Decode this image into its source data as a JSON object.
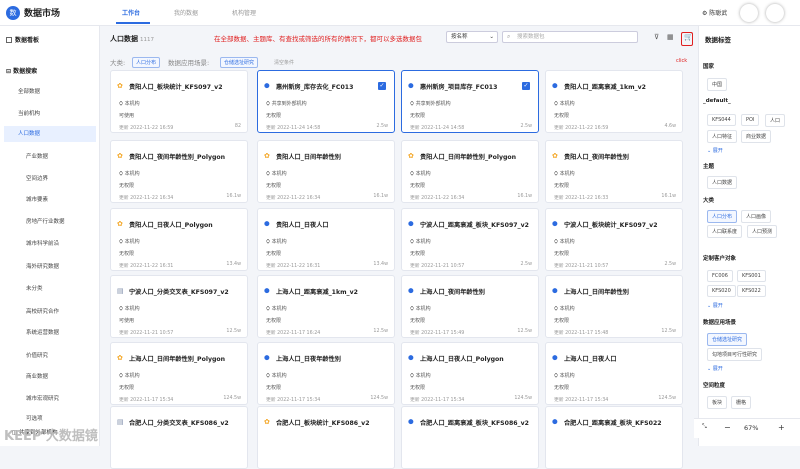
{
  "app": {
    "title": "数据市场",
    "logo_text": "数"
  },
  "top_tabs": [
    {
      "label": "工作台",
      "active": true
    },
    {
      "label": "我的数据"
    },
    {
      "label": "机构管理"
    }
  ],
  "user": {
    "name": "陈聪武"
  },
  "sidebar": {
    "board": "数据看板",
    "search_section": "数据搜索",
    "all_data": "全部数据",
    "current_org": "当前机构",
    "items": [
      "人口数据",
      "产业数据",
      "空间边界",
      "城市要素",
      "房地产行业数据",
      "城市科学前沿",
      "海外研究数据",
      "未分类",
      "高校研究合作",
      "系统运营数据",
      "价值研究",
      "商业数据",
      "城市宏观研究",
      "可选项"
    ],
    "active_item": "人口数据",
    "bottom": "共享到外部机构"
  },
  "main": {
    "title": "人口数据",
    "count": "1117",
    "sort": "按名称",
    "search_placeholder": "搜索数据包",
    "filter_label_big": "大类:",
    "filter_chip_1": "人口分布",
    "filter_label_scene": "数据应用场景:",
    "filter_chip_2": "仓储选址研究",
    "clear": "清空条件",
    "annotation": "在全部数据、主题库、有查找或筛选的所有的情况下，都可以多选数据包",
    "click_label": "click"
  },
  "cards": [
    {
      "icon": "cube",
      "title": "贵阳人口_板块统计_KFS097_v2",
      "org": "本机构",
      "perm": "可使用",
      "updated": "更新 2022-11-22 16:59",
      "size": "82"
    },
    {
      "icon": "pin",
      "title": "惠州新房_库存去化_FC013",
      "org": "共享到外部机构",
      "perm": "无权限",
      "updated": "更新 2022-11-24 14:58",
      "size": "2.5w",
      "selected": true
    },
    {
      "icon": "pin",
      "title": "惠州新房_项目库存_FC013",
      "org": "共享到外部机构",
      "perm": "无权限",
      "updated": "更新 2022-11-24 14:58",
      "size": "2.5w",
      "selected": true
    },
    {
      "icon": "pin",
      "title": "贵阳人口_距离衰减_1km_v2",
      "org": "本机构",
      "perm": "无权限",
      "updated": "更新 2022-11-22 16:59",
      "size": "4.6w"
    },
    {
      "icon": "cube",
      "title": "贵阳人口_夜间年龄性别_Polygon",
      "org": "本机构",
      "perm": "无权限",
      "updated": "更新 2022-11-22 16:34",
      "size": "16.1w"
    },
    {
      "icon": "cube",
      "title": "贵阳人口_日间年龄性别",
      "org": "本机构",
      "perm": "无权限",
      "updated": "更新 2022-11-22 16:34",
      "size": "16.1w"
    },
    {
      "icon": "cube",
      "title": "贵阳人口_日间年龄性别_Polygon",
      "org": "本机构",
      "perm": "无权限",
      "updated": "更新 2022-11-22 16:34",
      "size": "16.1w"
    },
    {
      "icon": "cube",
      "title": "贵阳人口_夜间年龄性别",
      "org": "本机构",
      "perm": "无权限",
      "updated": "更新 2022-11-22 16:33",
      "size": "16.1w"
    },
    {
      "icon": "cube",
      "title": "贵阳人口_日夜人口_Polygon",
      "org": "本机构",
      "perm": "无权限",
      "updated": "更新 2022-11-22 16:31",
      "size": "13.4w"
    },
    {
      "icon": "pin",
      "title": "贵阳人口_日夜人口",
      "org": "本机构",
      "perm": "无权限",
      "updated": "更新 2022-11-22 16:31",
      "size": "13.4w"
    },
    {
      "icon": "pin",
      "title": "宁波人口_距离衰减_板块_KFS097_v2",
      "org": "本机构",
      "perm": "无权限",
      "updated": "更新 2022-11-21 10:57",
      "size": "2.5w"
    },
    {
      "icon": "pin",
      "title": "宁波人口_板块统计_KFS097_v2",
      "org": "本机构",
      "perm": "无权限",
      "updated": "更新 2022-11-21 10:57",
      "size": "2.5w"
    },
    {
      "icon": "doc",
      "title": "宁波人口_分类交叉表_KFS097_v2",
      "org": "本机构",
      "perm": "可使用",
      "updated": "更新 2022-11-21 10:57",
      "size": "12.5w"
    },
    {
      "icon": "pin",
      "title": "上海人口_距离衰减_1km_v2",
      "org": "本机构",
      "perm": "无权限",
      "updated": "更新 2022-11-17 16:24",
      "size": "12.5w"
    },
    {
      "icon": "pin",
      "title": "上海人口_夜间年龄性别",
      "org": "本机构",
      "perm": "无权限",
      "updated": "更新 2022-11-17 15:49",
      "size": "12.5w"
    },
    {
      "icon": "pin",
      "title": "上海人口_日间年龄性别",
      "org": "本机构",
      "perm": "无权限",
      "updated": "更新 2022-11-17 15:48",
      "size": "12.5w"
    },
    {
      "icon": "cube",
      "title": "上海人口_日间年龄性别_Polygon",
      "org": "本机构",
      "perm": "无权限",
      "updated": "更新 2022-11-17 15:34",
      "size": "124.5w"
    },
    {
      "icon": "pin",
      "title": "上海人口_日夜年龄性别",
      "org": "本机构",
      "perm": "无权限",
      "updated": "更新 2022-11-17 15:34",
      "size": "124.5w"
    },
    {
      "icon": "pin",
      "title": "上海人口_日夜人口_Polygon",
      "org": "本机构",
      "perm": "无权限",
      "updated": "更新 2022-11-17 15:34",
      "size": "124.5w"
    },
    {
      "icon": "pin",
      "title": "上海人口_日夜人口",
      "org": "本机构",
      "perm": "无权限",
      "updated": "更新 2022-11-17 15:34",
      "size": "124.5w"
    },
    {
      "icon": "doc",
      "title": "合肥人口_分类交叉表_KFS086_v2",
      "org": "",
      "perm": "",
      "updated": "",
      "size": ""
    },
    {
      "icon": "cube",
      "title": "合肥人口_板块统计_KFS086_v2",
      "org": "",
      "perm": "",
      "updated": "",
      "size": ""
    },
    {
      "icon": "pin",
      "title": "合肥人口_距离衰减_板块_KFS086_v2",
      "org": "",
      "perm": "",
      "updated": "",
      "size": ""
    },
    {
      "icon": "pin",
      "title": "合肥人口_距离衰减_板块_KFS022",
      "org": "",
      "perm": "",
      "updated": "",
      "size": ""
    }
  ],
  "right_panel": {
    "title": "数据标签",
    "sections": {
      "country": "国家",
      "country_tags": [
        "中国"
      ],
      "default": "_default_",
      "default_tags": [
        "KFS044",
        "POI",
        "人口",
        "人口特征",
        "商业数据"
      ],
      "more": "展开",
      "theme": "主题",
      "theme_tags": [
        "人口数据"
      ],
      "big": "大类",
      "big_tags": [
        "人口分布",
        "人口画像",
        "人口联系度",
        "人口预测"
      ],
      "customer": "定制客户对象",
      "customer_tags": [
        "FC006",
        "KFS001",
        "KFS020",
        "KFS022"
      ],
      "scene": "数据应用场景",
      "scene_tags": [
        "仓储选址研究",
        "勾地项目可行性研究"
      ],
      "granularity": "空间粒度",
      "granularity_tags": [
        "板块",
        "栅格"
      ]
    }
  },
  "zoom": {
    "minus": "−",
    "percent": "67%",
    "plus": "+"
  },
  "watermark": "KEEP 大数据镜"
}
